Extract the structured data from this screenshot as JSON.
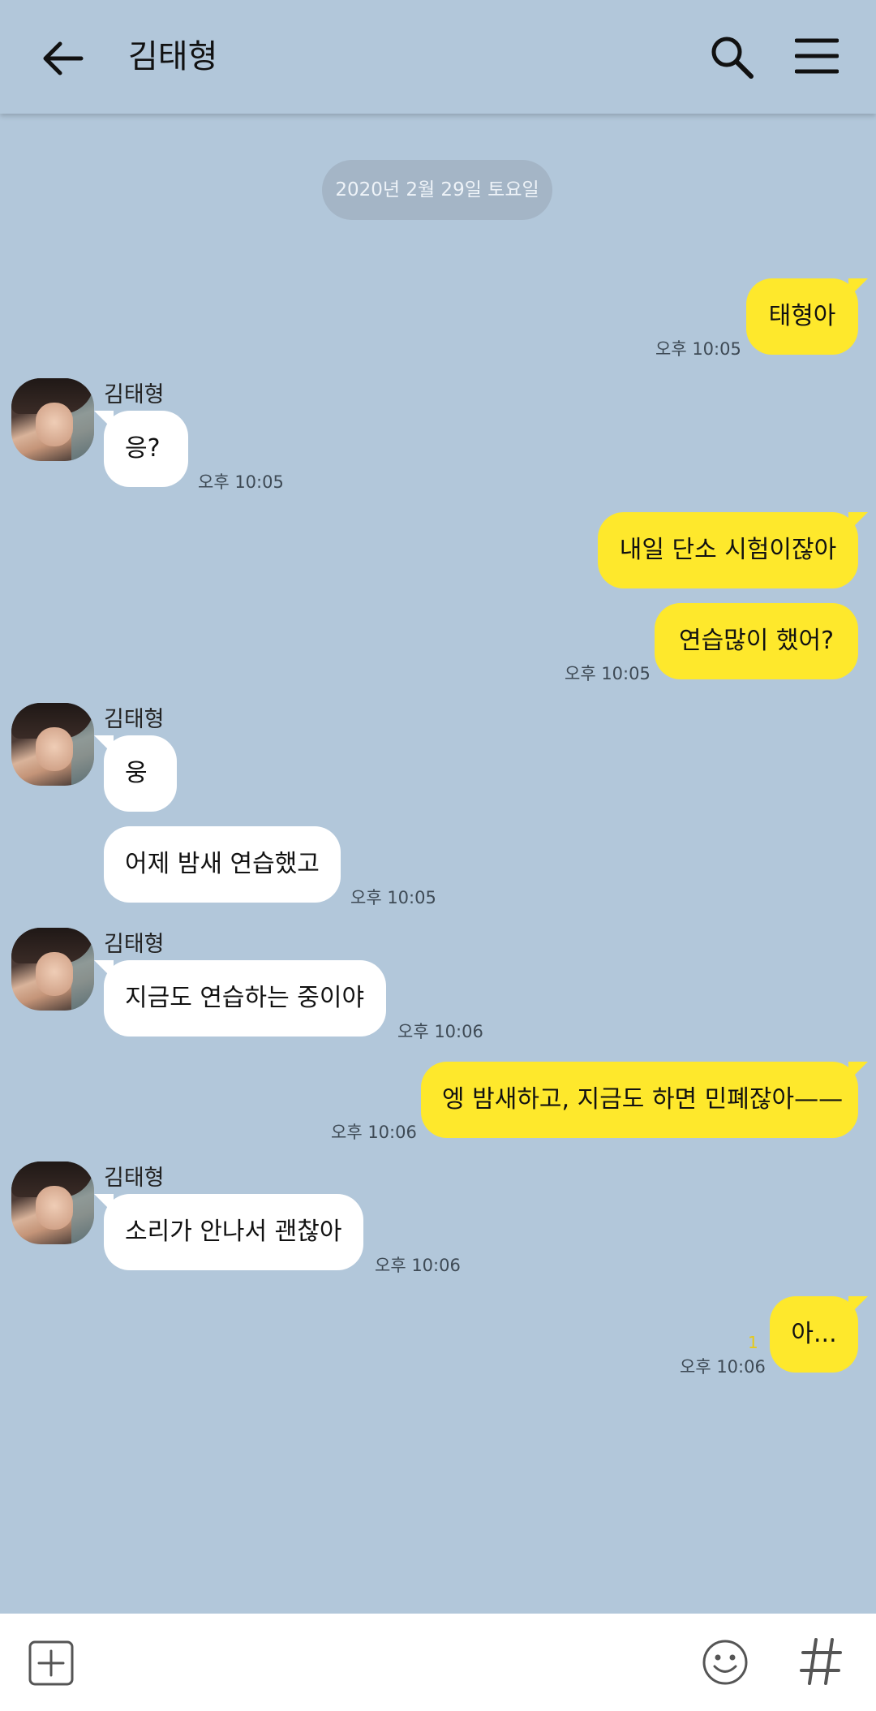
{
  "header": {
    "title": "김태형"
  },
  "date_divider": "2020년 2월 29일 토요일",
  "messages": [
    {
      "dir": "out",
      "text": "태형아",
      "time": "오후 10:05"
    },
    {
      "dir": "in",
      "sender": "김태형",
      "text": "응?",
      "time": "오후 10:05"
    },
    {
      "dir": "out",
      "text": "내일 단소 시험이잖아"
    },
    {
      "dir": "out",
      "text": "연습많이 했어?",
      "time": "오후 10:05"
    },
    {
      "dir": "in",
      "sender": "김태형",
      "text": "웅"
    },
    {
      "dir": "in",
      "text": "어제 밤새 연습했고",
      "time": "오후 10:05"
    },
    {
      "dir": "in",
      "sender": "김태형",
      "text": "지금도 연습하는 중이야",
      "time": "오후 10:06"
    },
    {
      "dir": "out",
      "text": "엥 밤새하고, 지금도 하면 민폐잖아——",
      "time": "오후 10:06"
    },
    {
      "dir": "in",
      "sender": "김태형",
      "text": "소리가 안나서 괜찮아",
      "time": "오후 10:06"
    },
    {
      "dir": "out",
      "text": "아...",
      "time": "오후 10:06",
      "unread": "1"
    }
  ],
  "colors": {
    "background": "#b2c7da",
    "outgoing": "#fee82c",
    "incoming": "#ffffff"
  }
}
